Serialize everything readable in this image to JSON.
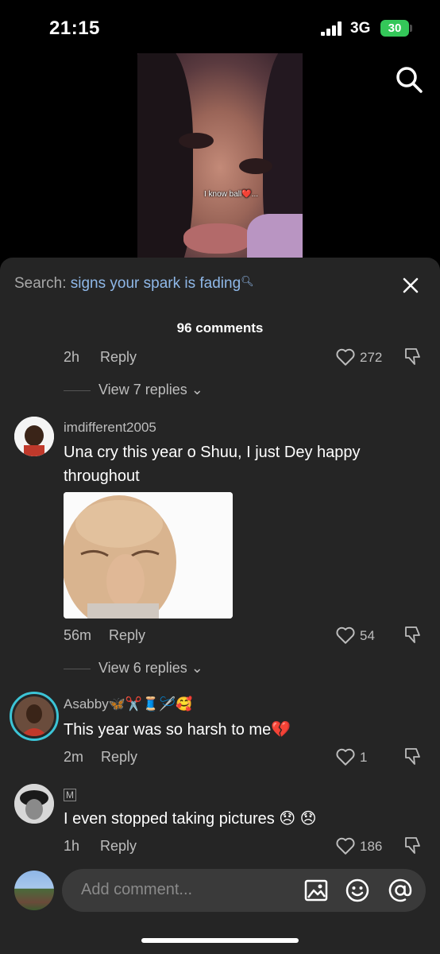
{
  "status_bar": {
    "time": "21:15",
    "network": "3G",
    "battery": "30"
  },
  "video": {
    "caption": "I know ball❤️..."
  },
  "sheet": {
    "search_label": "Search:",
    "search_query": "signs your spark is fading",
    "comment_count": "96 comments"
  },
  "comments": [
    {
      "time": "2h",
      "reply": "Reply",
      "likes": "272",
      "view_replies": "View 7 replies"
    },
    {
      "username": "imdifferent2005",
      "text": "Una cry this year o Shuu, I just Dey happy throughout",
      "time": "56m",
      "reply": "Reply",
      "likes": "54",
      "view_replies": "View 6 replies"
    },
    {
      "username": "Asabby🦋✂️🧵🪡🥰",
      "text": "This year was so harsh to me💔",
      "time": "2m",
      "reply": "Reply",
      "likes": "1"
    },
    {
      "username": "M",
      "text": "I even stopped taking pictures 😞 😞",
      "time": "1h",
      "reply": "Reply",
      "likes": "186"
    }
  ],
  "input": {
    "placeholder": "Add comment..."
  },
  "icons": [
    "search-icon",
    "close-icon",
    "heart-icon",
    "dislike-icon",
    "image-icon",
    "emoji-icon",
    "mention-icon",
    "chevron-down-icon"
  ],
  "colors": {
    "sheet_bg": "#252525",
    "search_query": "#8fb8e8",
    "battery": "#34c759"
  }
}
